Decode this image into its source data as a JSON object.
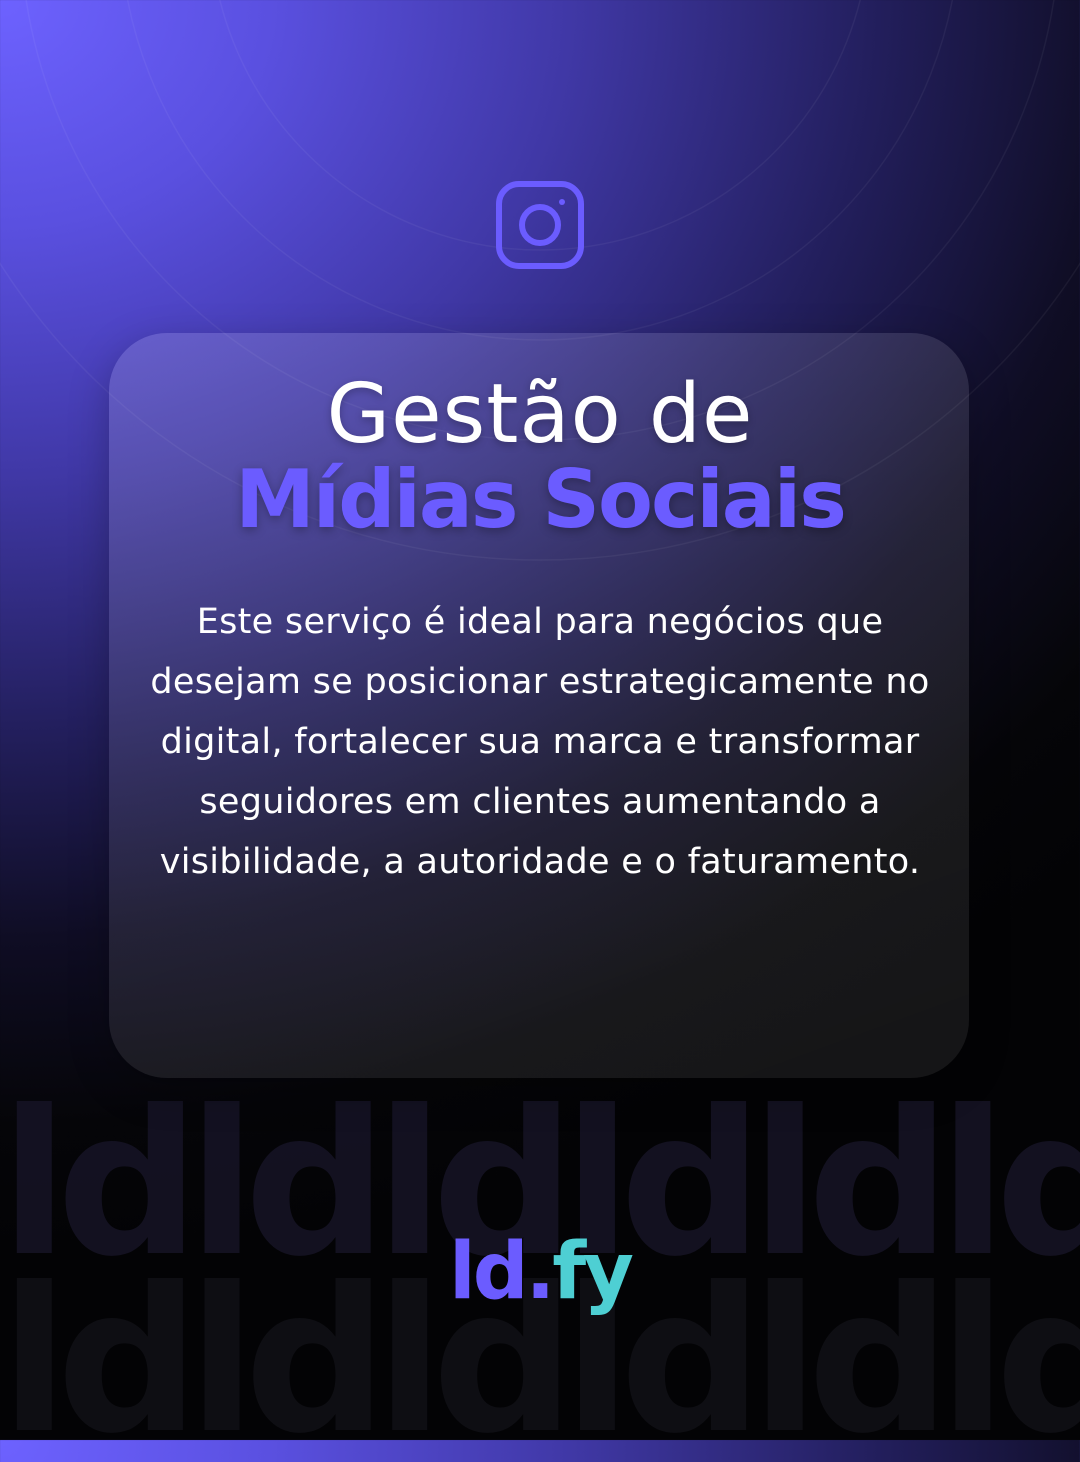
{
  "colors": {
    "accent": "#6b5cff",
    "brand_secondary": "#4ecfd3",
    "text": "#ffffff"
  },
  "icon": "instagram-icon",
  "title": {
    "line1": "Gestão de",
    "line2": "Mídias Sociais"
  },
  "description": "Este serviço é ideal para negócios que desejam se posicionar estrategicamente no digital, fortalecer sua marca e transformar seguidores em clientes aumentando a visibilidade, a autoridade e o faturamento.",
  "brand": {
    "part1": "ld",
    "dot": ".",
    "part2": "fy"
  },
  "background_pattern": {
    "row1": "ldldldldldldld",
    "row2": "ldldldldldldld"
  }
}
